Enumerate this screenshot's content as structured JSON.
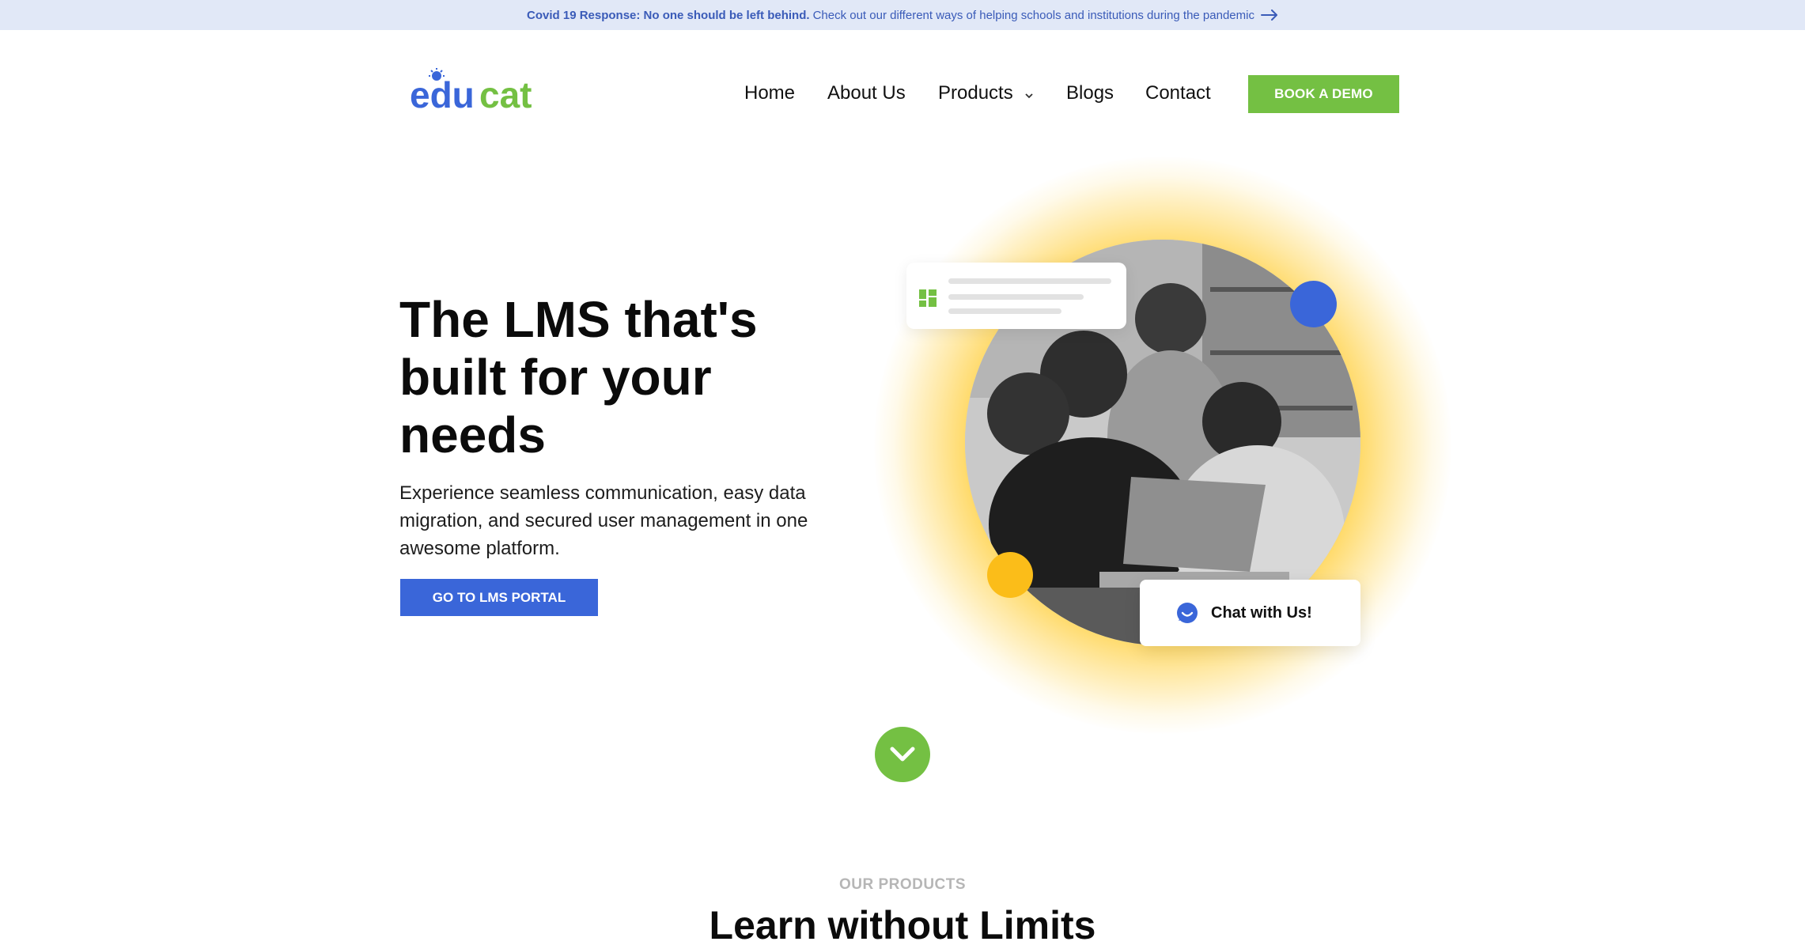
{
  "banner": {
    "bold_text": "Covid 19 Response: No one should be left behind.",
    "text": "Check out our different ways of helping schools and institutions during the pandemic",
    "arrow_icon": "arrow-right-icon"
  },
  "brand": {
    "logo_part1": "edu",
    "logo_part2": "cat",
    "color_blue": "#3a66d9",
    "color_green": "#74c043"
  },
  "nav": {
    "home": "Home",
    "about": "About Us",
    "products": "Products",
    "blogs": "Blogs",
    "contact": "Contact",
    "demo_button": "BOOK A DEMO"
  },
  "hero": {
    "title_line1": "The LMS that's",
    "title_line2": "built for your",
    "title_line3": "needs",
    "subtitle": "Experience seamless communication, easy data migration, and secured user management in one awesome platform.",
    "cta": "GO TO LMS PORTAL"
  },
  "chat": {
    "label": "Chat with Us!",
    "icon": "chat-bubble-icon"
  },
  "products_section": {
    "eyebrow": "OUR PRODUCTS",
    "title": "Learn without Limits"
  }
}
